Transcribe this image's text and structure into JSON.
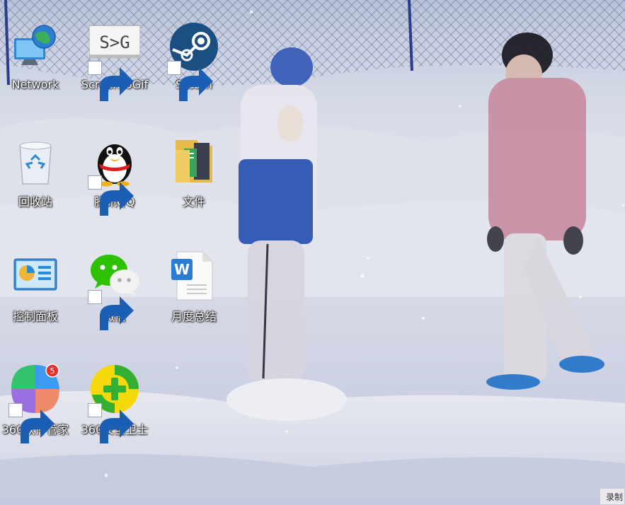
{
  "desktop": {
    "icons": [
      {
        "label": "Network",
        "icon": "network-icon",
        "shortcut": false
      },
      {
        "label": "ScreenToGif",
        "icon": "screentogif-icon",
        "shortcut": true
      },
      {
        "label": "Steam",
        "icon": "steam-icon",
        "shortcut": true
      },
      {
        "label": "回收站",
        "icon": "recycle-bin-icon",
        "shortcut": false
      },
      {
        "label": "腾讯QQ",
        "icon": "qq-penguin-icon",
        "shortcut": true
      },
      {
        "label": "文件",
        "icon": "folder-icon",
        "shortcut": false
      },
      {
        "label": "控制面板",
        "icon": "control-panel-icon",
        "shortcut": false
      },
      {
        "label": "微信",
        "icon": "wechat-icon",
        "shortcut": true
      },
      {
        "label": "月度总结",
        "icon": "word-document-icon",
        "shortcut": false
      },
      {
        "label": "360软件管家",
        "icon": "360-software-manager-icon",
        "shortcut": true,
        "badge": "5"
      },
      {
        "label": "360安全卫士",
        "icon": "360-security-icon",
        "shortcut": true
      }
    ],
    "screentogif_logo_text": "S>G",
    "word_letter": "W",
    "corner_widget_text": "录制"
  },
  "colors": {
    "label_text": "#ffffff",
    "steam_blue": "#1b6fa8",
    "qq_black": "#111111",
    "wechat_green": "#2dc100",
    "word_blue": "#2b7cd3",
    "security_green": "#33b034",
    "security_yellow": "#f5d90a"
  }
}
